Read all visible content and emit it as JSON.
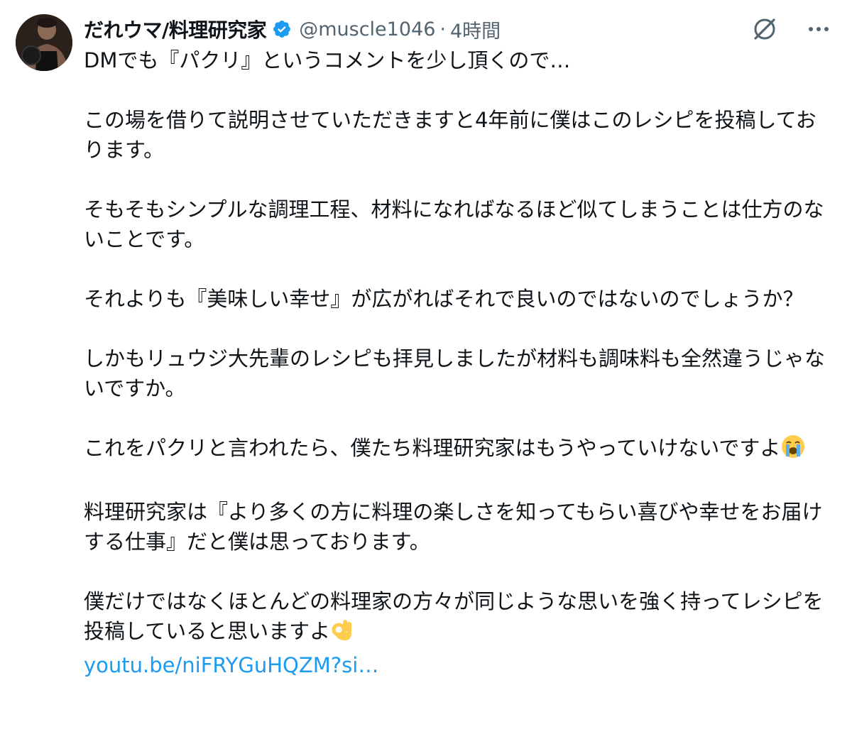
{
  "tweet": {
    "display_name": "だれウマ/料理研究家",
    "handle": "@muscle1046",
    "separator": "·",
    "time": "4時間",
    "paragraphs": [
      "DMでも『パクリ』というコメントを少し頂くので…",
      "この場を借りて説明させていただきますと4年前に僕はこのレシピを投稿しております。",
      "そもそもシンプルな調理工程、材料になればなるほど似てしまうことは仕方のないことです。",
      "それよりも『美味しい幸せ』が広がればそれで良いのではないのでしょうか？",
      "しかもリュウジ大先輩のレシピも拝見しましたが材料も調味料も全然違うじゃないですか。",
      "これをパクリと言われたら、僕たち料理研究家はもうやっていけないですよ",
      "料理研究家は『より多くの方に料理の楽しさを知ってもらい喜びや幸せをお届けする仕事』だと僕は思っております。",
      "僕だけではなくほとんどの料理家の方々が同じような思いを強く持ってレシピを投稿していると思いますよ"
    ],
    "emojis": {
      "crying": "crying-face-emoji",
      "ok_hand": "ok-hand-emoji"
    },
    "link_text": "youtu.be/niFRYGuHQZM?si…"
  },
  "icons": {
    "verified": "verified-badge-icon",
    "grok": "grok-icon",
    "more": "more-icon"
  },
  "colors": {
    "text": "#0f1419",
    "secondary": "#536471",
    "accent": "#1d9bf0"
  }
}
